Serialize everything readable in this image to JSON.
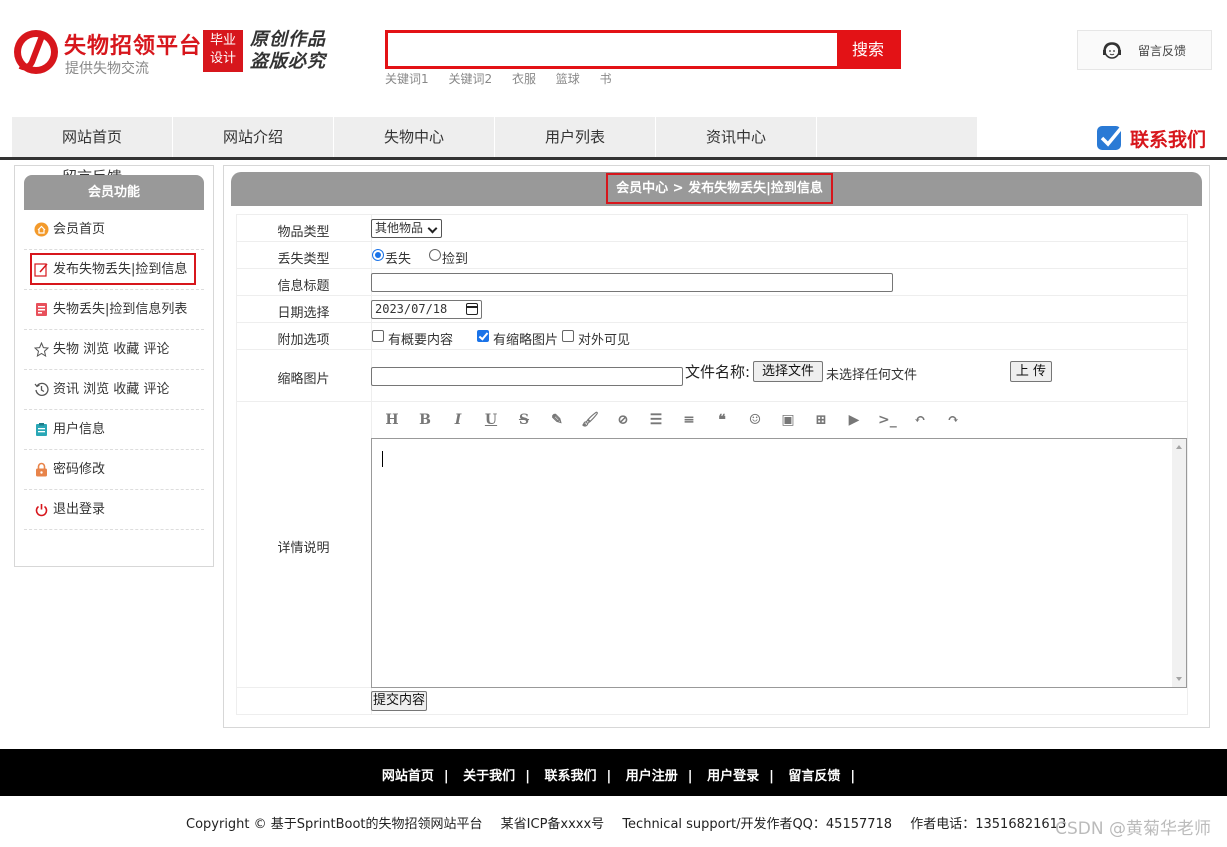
{
  "header": {
    "site_name": "失物招领平台",
    "slogan": "提供失物交流",
    "badge_line1": "毕业",
    "badge_line2": "设计",
    "calligraphy_line1": "原创作品",
    "calligraphy_line2": "盗版必究",
    "search": {
      "placeholder": "",
      "button": "搜索"
    },
    "keywords": [
      "关键词1",
      "关键词2",
      "衣服",
      "篮球",
      "书"
    ],
    "feedback": "留言反馈"
  },
  "nav": {
    "items": [
      "网站首页",
      "网站介绍",
      "失物中心",
      "用户列表",
      "资讯中心",
      "留言反馈"
    ],
    "contact": "联系我们"
  },
  "sidebar": {
    "title": "会员功能",
    "items": [
      {
        "label": "会员首页",
        "icon": "home-icon"
      },
      {
        "label": "发布失物丢失|捡到信息",
        "icon": "edit-icon"
      },
      {
        "label": "失物丢失|捡到信息列表",
        "icon": "list-icon"
      },
      {
        "label": "失物 浏览 收藏 评论",
        "icon": "star-icon"
      },
      {
        "label": "资讯 浏览 收藏 评论",
        "icon": "history-icon"
      },
      {
        "label": "用户信息",
        "icon": "user-info-icon"
      },
      {
        "label": "密码修改",
        "icon": "lock-icon"
      },
      {
        "label": "退出登录",
        "icon": "power-icon"
      }
    ]
  },
  "main": {
    "breadcrumb": "会员中心 > 发布失物丢失|捡到信息",
    "form": {
      "item_type_label": "物品类型",
      "item_type_value": "其他物品",
      "loss_type_label": "丢失类型",
      "loss_opt_lost": "丢失",
      "loss_opt_found": "捡到",
      "title_label": "信息标题",
      "title_value": "",
      "date_label": "日期选择",
      "date_value": "2023/07/18",
      "extra_label": "附加选项",
      "extra_opt1": "有概要内容",
      "extra_opt2": "有缩略图片",
      "extra_opt3": "对外可见",
      "thumb_label": "缩略图片",
      "file_name_label": "文件名称:",
      "choose_file": "选择文件",
      "no_file": "未选择任何文件",
      "upload": "上 传",
      "detail_label": "详情说明",
      "toolbar": [
        "heading-icon",
        "bold-icon",
        "italic-icon",
        "underline-icon",
        "strikethrough-icon",
        "pen-icon",
        "brush-icon",
        "link-icon",
        "bullet-list-icon",
        "align-icon",
        "quote-icon",
        "emoji-icon",
        "image-icon",
        "table-icon",
        "video-icon",
        "code-icon",
        "undo-icon",
        "redo-icon"
      ],
      "submit": "提交内容"
    }
  },
  "footer": {
    "links": [
      "网站首页",
      "关于我们",
      "联系我们",
      "用户注册",
      "用户登录",
      "留言反馈"
    ],
    "copyright": "Copyright © 基于SprintBoot的失物招领网站平台",
    "icp": "某省ICP备xxxx号",
    "support": "Technical support/开发作者QQ：45157718",
    "phone": "作者电话：13516821613",
    "watermark": "CSDN @黄菊华老师"
  },
  "colors": {
    "brand_red": "#d7161c",
    "nav_bg": "#eeeeee",
    "panel_grey": "#999999",
    "footer_bg": "#000000"
  }
}
